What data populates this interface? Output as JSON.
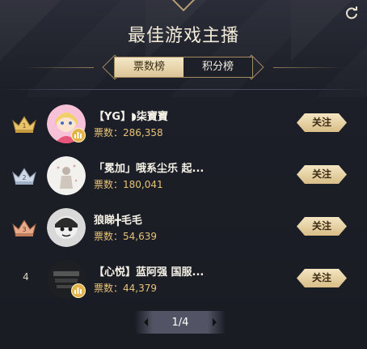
{
  "header": {
    "title": "最佳游戏主播",
    "refresh_icon": "refresh-icon"
  },
  "tabs": [
    {
      "label": "票数榜",
      "active": true
    },
    {
      "label": "积分榜",
      "active": false
    }
  ],
  "streamers": [
    {
      "rank": "1",
      "rank_icon": "crown-gold-icon",
      "name": "【YG】◗柒寶寶",
      "votes": "票数：286,358",
      "follow_label": "关注",
      "badge": true
    },
    {
      "rank": "2",
      "rank_icon": "crown-silver-icon",
      "name": "「冕加」哦系尘乐 起...",
      "votes": "票数：180,041",
      "follow_label": "关注",
      "badge": false
    },
    {
      "rank": "3",
      "rank_icon": "crown-bronze-icon",
      "name": "狼睇╋毛毛",
      "votes": "票数：54,639",
      "follow_label": "关注",
      "badge": false
    },
    {
      "rank": "4",
      "rank_icon": "",
      "name": "【心悦】蓝阿强 国服...",
      "votes": "票数：44,379",
      "follow_label": "关注",
      "badge": true
    }
  ],
  "pagination": {
    "text": "1/4"
  },
  "colors": {
    "gold": "#e6c279",
    "button": "#d8bd87",
    "background": "#1b1d25"
  }
}
